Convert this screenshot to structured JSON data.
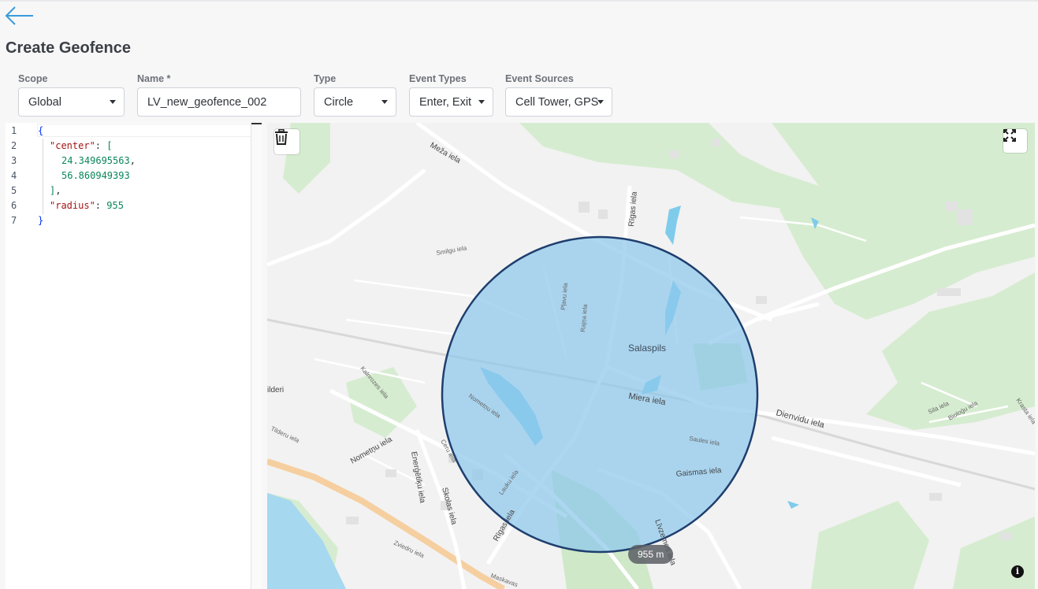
{
  "page": {
    "title": "Create Geofence"
  },
  "form": {
    "scope": {
      "label": "Scope",
      "value": "Global"
    },
    "name": {
      "label": "Name *",
      "value": "LV_new_geofence_002"
    },
    "type": {
      "label": "Type",
      "value": "Circle"
    },
    "event_types": {
      "label": "Event Types",
      "value": "Enter, Exit"
    },
    "event_sources": {
      "label": "Event Sources",
      "value": "Cell Tower, GPS"
    }
  },
  "editor": {
    "line_numbers": [
      "1",
      "2",
      "3",
      "4",
      "5",
      "6",
      "7"
    ],
    "lines": [
      [
        "{"
      ],
      [
        "\"center\"",
        ": ",
        "["
      ],
      [
        "24.349695563",
        ","
      ],
      [
        "56.860949393"
      ],
      [
        "]",
        ","
      ],
      [
        "\"radius\"",
        ": ",
        "955"
      ],
      [
        "}"
      ]
    ]
  },
  "map": {
    "radius_label": "955 m",
    "center_label": "Salaspils",
    "street_labels": [
      "Meža iela",
      "Rīgas iela",
      "Smilgu iela",
      "Pļavu iela",
      "Rajņa iela",
      "Salaspils",
      "Miera iela",
      "Dienvidu iela",
      "Nometņu iela",
      "Kalnrozes iela",
      "Tilderu iela",
      "ilderi",
      "Nometņu iela",
      "Ceru iela",
      "Enerģētiķu iela",
      "Skolas iela",
      "Lauku iela",
      "Rīgas iela",
      "Saules iela",
      "Gaismas iela",
      "Līvzemes iela",
      "Zviedru iela",
      "Maskavas",
      "Sila iela",
      "Bioloģu iela",
      "Krasta iela"
    ],
    "colors": {
      "circle_fill": "#8dc8ec",
      "circle_stroke": "#1f3f6e",
      "forest": "#d6ecd0",
      "water": "#a6d8f0",
      "accent": "#3b9ad9"
    },
    "info_glyph": "i"
  },
  "icons": {
    "back": "arrow-left-icon",
    "trash": "trash-icon",
    "fullscreen": "fullscreen-icon",
    "info": "info-icon"
  }
}
